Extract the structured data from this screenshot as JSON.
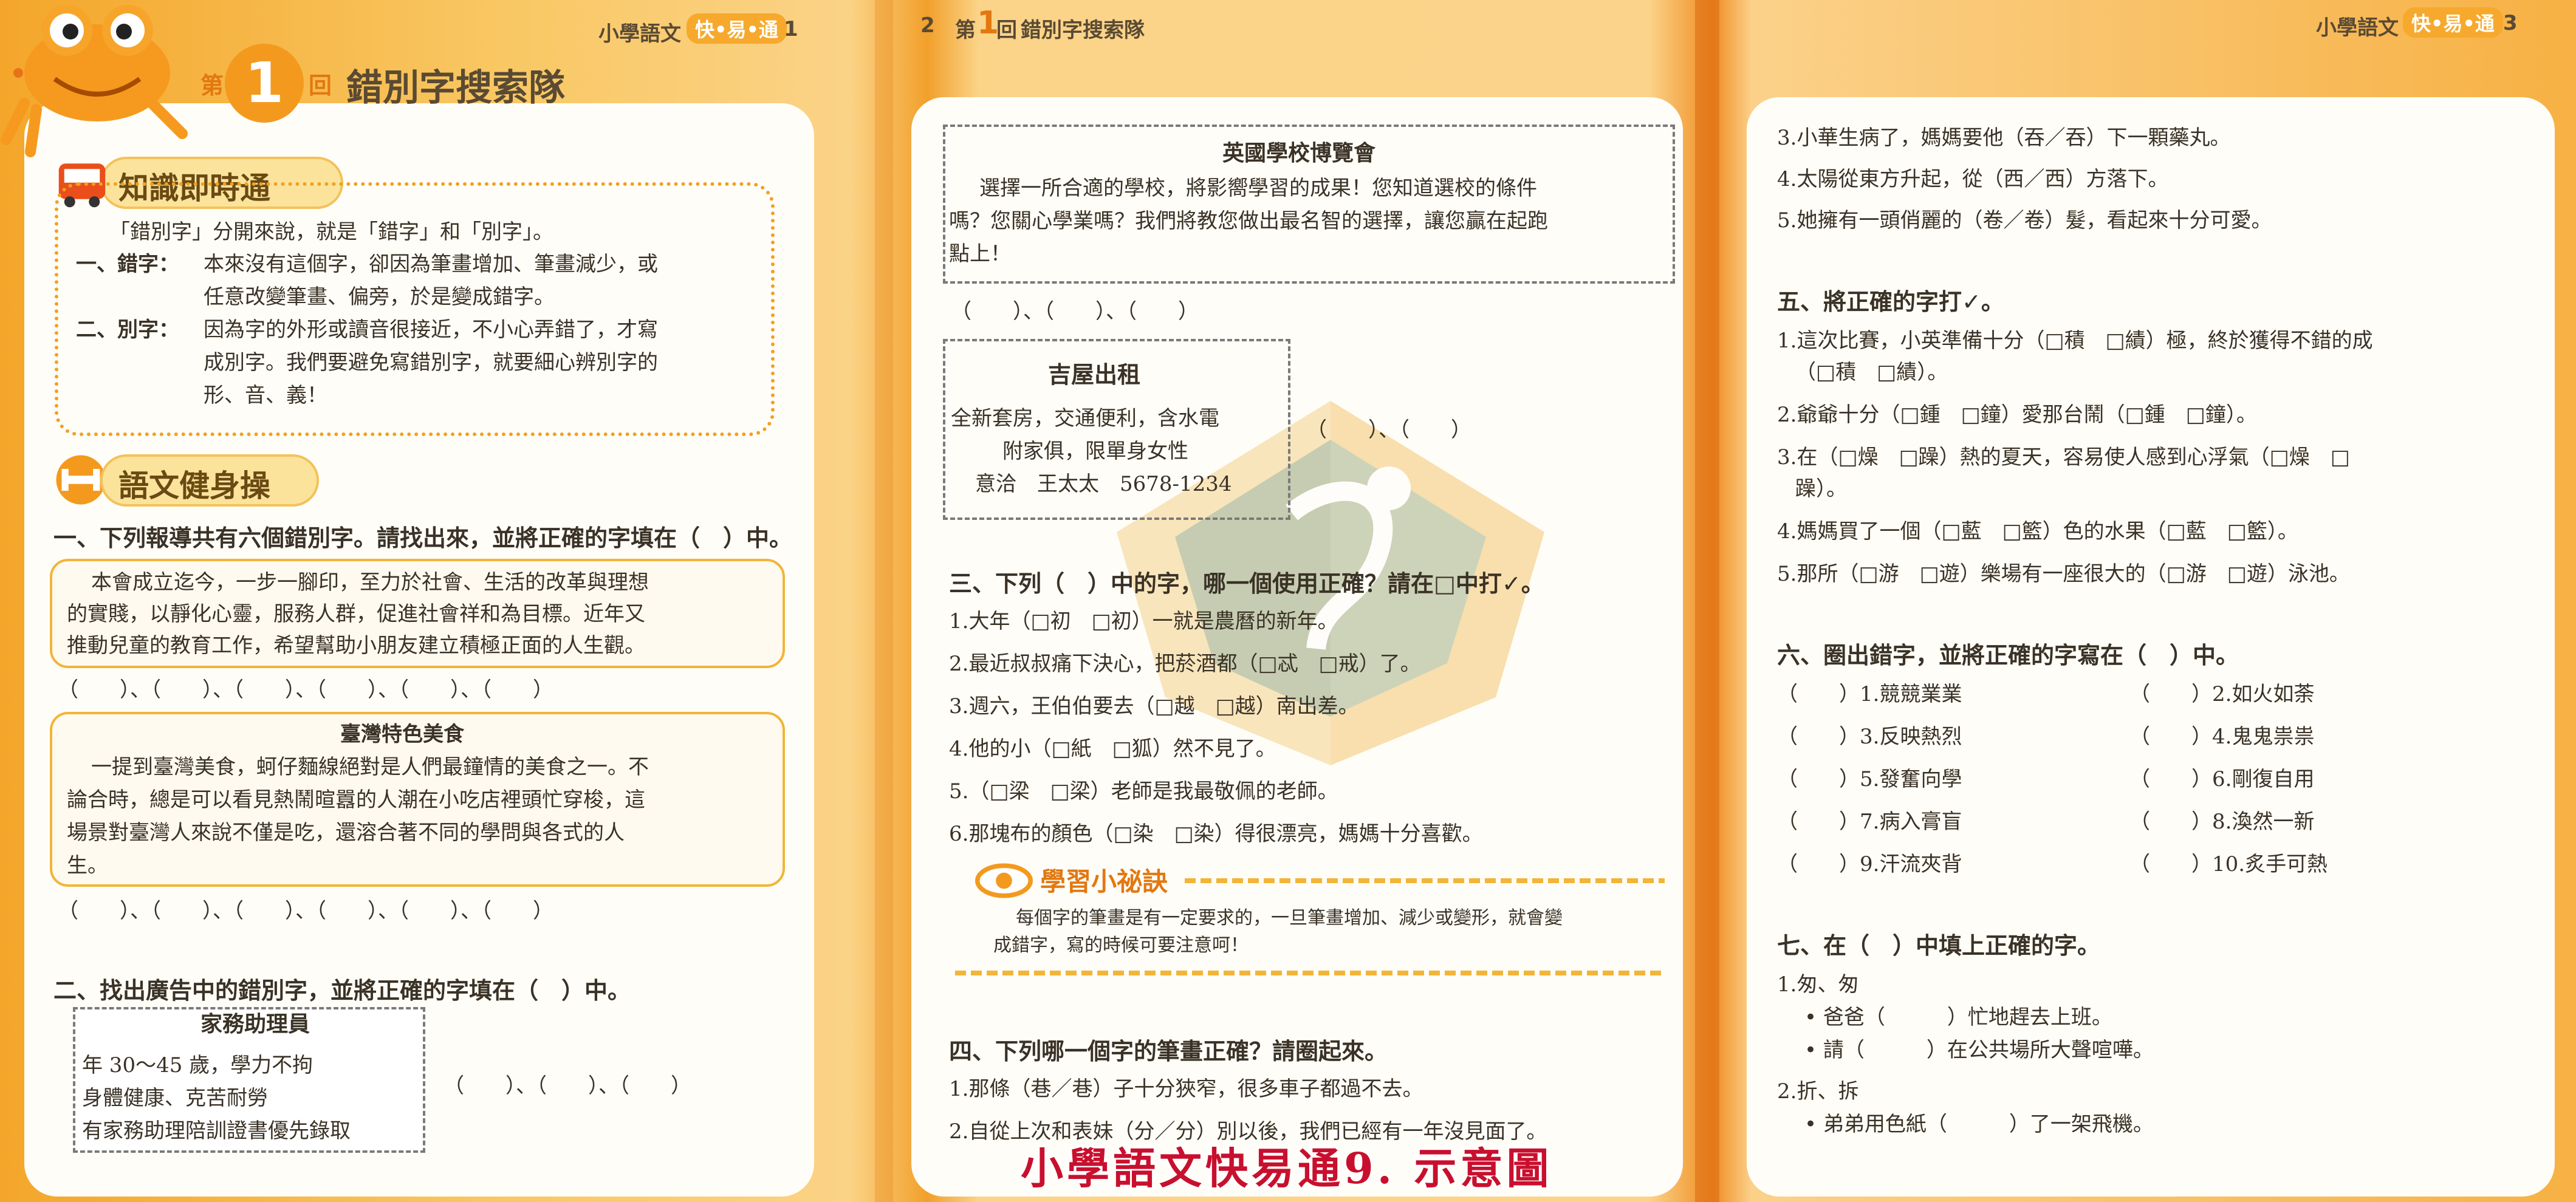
{
  "pages": {
    "left": {
      "header_book": "小學語文",
      "header_badge": "快•易•通",
      "page_no": "1",
      "lesson_prefix": "第",
      "lesson_num": "1",
      "lesson_suffix": "回",
      "lesson_title": "錯別字搜索隊",
      "knowledge": {
        "title": "知識即時通",
        "intro": "「錯別字」分開來說，就是「錯字」和「別字」。",
        "item1_label": "一、錯字：",
        "item1_lines": [
          "本來沒有這個字，卻因為筆畫增加、筆畫減少，或",
          "任意改變筆畫、偏旁，於是變成錯字。"
        ],
        "item2_label": "二、別字：",
        "item2_lines": [
          "因為字的外形或讀音很接近，不小心弄錯了，才寫",
          "成別字。我們要避免寫錯別字，就要細心辨別字的",
          "形、音、義！"
        ]
      },
      "workout_title": "語文健身操",
      "q1": {
        "title": "一、下列報導共有六個錯別字。請找出來，並將正確的字填在（　）中。",
        "news1": [
          "本會成立迄今，一步一腳印，至力於社會、生活的改革與理想",
          "的實賤，以靜化心靈，服務人群，促進社會祥和為目標。近年又",
          "推動兒童的教育工作，希望幫助小朋友建立積極正面的人生觀。"
        ],
        "blanks1": "（　　）、（　　）、（　　）、（　　）、（　　）、（　　）",
        "news2_title": "臺灣特色美食",
        "news2": [
          "一提到臺灣美食，蚵仔麵線絕對是人們最鐘情的美食之一。不",
          "論合時，總是可以看見熱鬧暄囂的人潮在小吃店裡頭忙穿梭，這",
          "場景對臺灣人來說不僅是吃，還溶合著不同的學問與各式的人",
          "生。"
        ],
        "blanks2": "（　　）、（　　）、（　　）、（　　）、（　　）、（　　）"
      },
      "q2": {
        "title": "二、找出廣告中的錯別字，並將正確的字填在（　）中。",
        "ad_title": "家務助理員",
        "ad_lines": [
          "年 30～45 歲，學力不拘",
          "身體健康、克苦耐勞",
          "有家務助理陪訓證書優先錄取"
        ],
        "blanks": "（　　）、（　　）、（　　）"
      }
    },
    "middle": {
      "page_no": "2",
      "header_prefix": "第",
      "header_num": "1",
      "header_suffix": "回",
      "header_title": "錯別字搜索隊",
      "ad1_title": "英國學校博覽會",
      "ad1_lines": [
        "選擇一所合適的學校，將影嚮學習的成果！您知道選校的條件",
        "嗎？您關心學業嗎？我們將教您做出最名智的選擇，讓您贏在起跑",
        "點上！"
      ],
      "ad1_blanks": "（　　）、（　　）、（　　）",
      "ad2_title": "吉屋出租",
      "ad2_lines": [
        "全新套房，交通便利，含水電",
        "附家俱，限單身女性",
        "意洽　王太太　5678-1234"
      ],
      "ad2_blanks": "（　　）、（　　）",
      "q3_title": "三、下列（　）中的字，哪一個使用正確？請在□中打✓。",
      "q3_items": [
        "1.大年（□初　□初）一就是農曆的新年。",
        "2.最近叔叔痛下決心，把菸酒都（□忒　□戒）了。",
        "3.週六，王伯伯要去（□越　□越）南出差。",
        "4.他的小（□紙　□狐）然不見了。",
        "5.（□梁　□梁）老師是我最敬佩的老師。",
        "6.那塊布的顏色（□染　□染）得很漂亮，媽媽十分喜歡。"
      ],
      "tip_title": "學習小祕訣",
      "tip_lines": [
        "每個字的筆畫是有一定要求的，一旦筆畫增加、減少或變形，就會變",
        "成錯字，寫的時候可要注意呵！"
      ],
      "q4_title": "四、下列哪一個字的筆畫正確？請圈起來。",
      "q4_items": [
        "1.那條（巷／巷）子十分狹窄，很多車子都過不去。",
        "2.自從上次和表妹（分／分）別以後，我們已經有一年沒見面了。"
      ]
    },
    "right": {
      "header_book": "小學語文",
      "header_badge": "快•易•通",
      "page_no": "3",
      "q4_cont": [
        "3.小華生病了，媽媽要他（吞／吞）下一顆藥丸。",
        "4.太陽從東方升起，從（西／西）方落下。",
        "5.她擁有一頭俏麗的（卷／卷）髮，看起來十分可愛。"
      ],
      "q5_title": "五、將正確的字打✓。",
      "q5_items": [
        "1.這次比賽，小英準備十分（□積　□績）極，終於獲得不錯的成",
        "（□積　□績）。",
        "2.爺爺十分（□鍾　□鐘）愛那台鬧（□鍾　□鐘）。",
        "3.在（□燥　□躁）熱的夏天，容易使人感到心浮氣（□燥　□",
        "躁）。",
        "4.媽媽買了一個（□藍　□籃）色的水果（□藍　□籃）。",
        "5.那所（□游　□遊）樂場有一座很大的（□游　□遊）泳池。"
      ],
      "q6_title": "六、圈出錯字，並將正確的字寫在（　）中。",
      "q6_left": [
        "（　　）1.競競業業",
        "（　　）3.反映熱烈",
        "（　　）5.發奮向學",
        "（　　）7.病入膏盲",
        "（　　）9.汗流夾背"
      ],
      "q6_right": [
        "（　　）2.如火如荼",
        "（　　）4.鬼鬼祟祟",
        "（　　）6.剛復自用",
        "（　　）8.渙然一新",
        "（　　）10.炙手可熱"
      ],
      "q7_title": "七、在（　）中填上正確的字。",
      "q7_g1_title": "1.匆、匆",
      "q7_g1": [
        "• 爸爸（　　　）忙地趕去上班。",
        "• 請（　　　）在公共場所大聲喧嘩。"
      ],
      "q7_g2_title": "2.折、拆",
      "q7_g2": [
        "• 弟弟用色紙（　　　）了一架飛機。"
      ]
    }
  },
  "caption": "小學語文快易通9. 示意圖",
  "colors": {
    "orange": "#f6a92c",
    "accent": "#f3b437",
    "caption": "#c8102e"
  }
}
